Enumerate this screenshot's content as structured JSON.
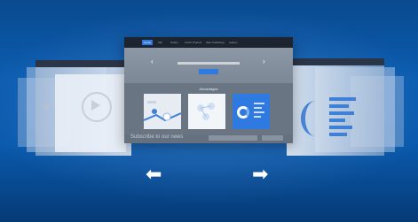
{
  "colors": {
    "background": "#0b5cb0",
    "accent": "#2f7ae0"
  },
  "center": {
    "nav_tabs": [
      "Home",
      "Tab",
      "Studio",
      "UI/UX Product",
      "Web Publishing",
      "Gallery"
    ],
    "hero_prev": "‹",
    "hero_next": "›",
    "advantages_heading": "Advantages"
  },
  "subscribe": {
    "label": "Subscribe to our news"
  },
  "arrows": {
    "left": "⬅",
    "right": "➡"
  }
}
